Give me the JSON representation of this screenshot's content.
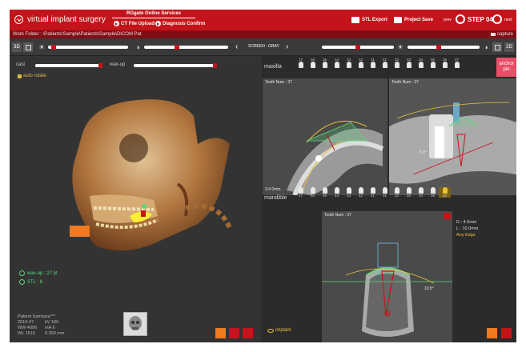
{
  "header": {
    "app_title": "virtual implant surgery",
    "service_title": "RGgate Online Services",
    "ct_upload_label": "CT File Upload",
    "diagnosis_label": "Diagnosis Confirm",
    "stl_export_label": "STL Export",
    "project_save_label": "Project Save",
    "prev_label": "prev",
    "step_label": "STEP 04",
    "next_label": "next"
  },
  "path_bar": {
    "work_folder": "Work Folder : \\Patients\\Sample\\Patients\\Sample\\DICOM Pat",
    "capture_label": "capture"
  },
  "toolbar": {
    "mode_3d": "3D",
    "mode_2d": "2D",
    "screen_label": "SCREEN : GRAY"
  },
  "view3d": {
    "cast_label": "cast",
    "wax_up_label": "wax-up",
    "auto_rotate_label": "auto rotate",
    "wax_up_status": "wax-up : 27 pt",
    "stl_status": "STL : 8",
    "info_rows": [
      {
        "k": "Patient Samsara***",
        "v": ""
      },
      {
        "k": "2010-07",
        "v": "kV 100"
      },
      {
        "k": "WW 4096",
        "v": "mA 6"
      },
      {
        "k": "WL 1616",
        "v": "0.300 mm"
      }
    ]
  },
  "maxilla": {
    "label": "maxilla",
    "teeth": [
      "17",
      "16",
      "15",
      "14",
      "13",
      "12",
      "11",
      "21",
      "22",
      "23",
      "24",
      "25",
      "26",
      "27"
    ]
  },
  "mandible": {
    "label": "mandible",
    "teeth": [
      "47",
      "46",
      "45",
      "44",
      "43",
      "42",
      "41",
      "31",
      "32",
      "33",
      "34",
      "35",
      "36"
    ],
    "selected_tooth_index": 12
  },
  "anchor_pin_label": "anchor pin",
  "ct_views": {
    "axial_caption": "Tooth Num : 37",
    "axial_measure": "3.4   0mm",
    "sagittal_caption": "Tooth Num : 37",
    "sagittal_angle": "5.8°",
    "cross_caption": "Tooth Num : 37",
    "cross_angle": "10.5°"
  },
  "implant_spec": {
    "diameter": "D : 4.5mm",
    "length": "L : 10.0mm",
    "note": "Any Edge"
  },
  "implant_toggle_label": "implant",
  "colors": {
    "brand_red": "#c4141b",
    "accent_orange": "#f07a20",
    "accent_yellow": "#e8c23a",
    "anchor_pink": "#e94f68",
    "status_green": "#5cd87a"
  }
}
